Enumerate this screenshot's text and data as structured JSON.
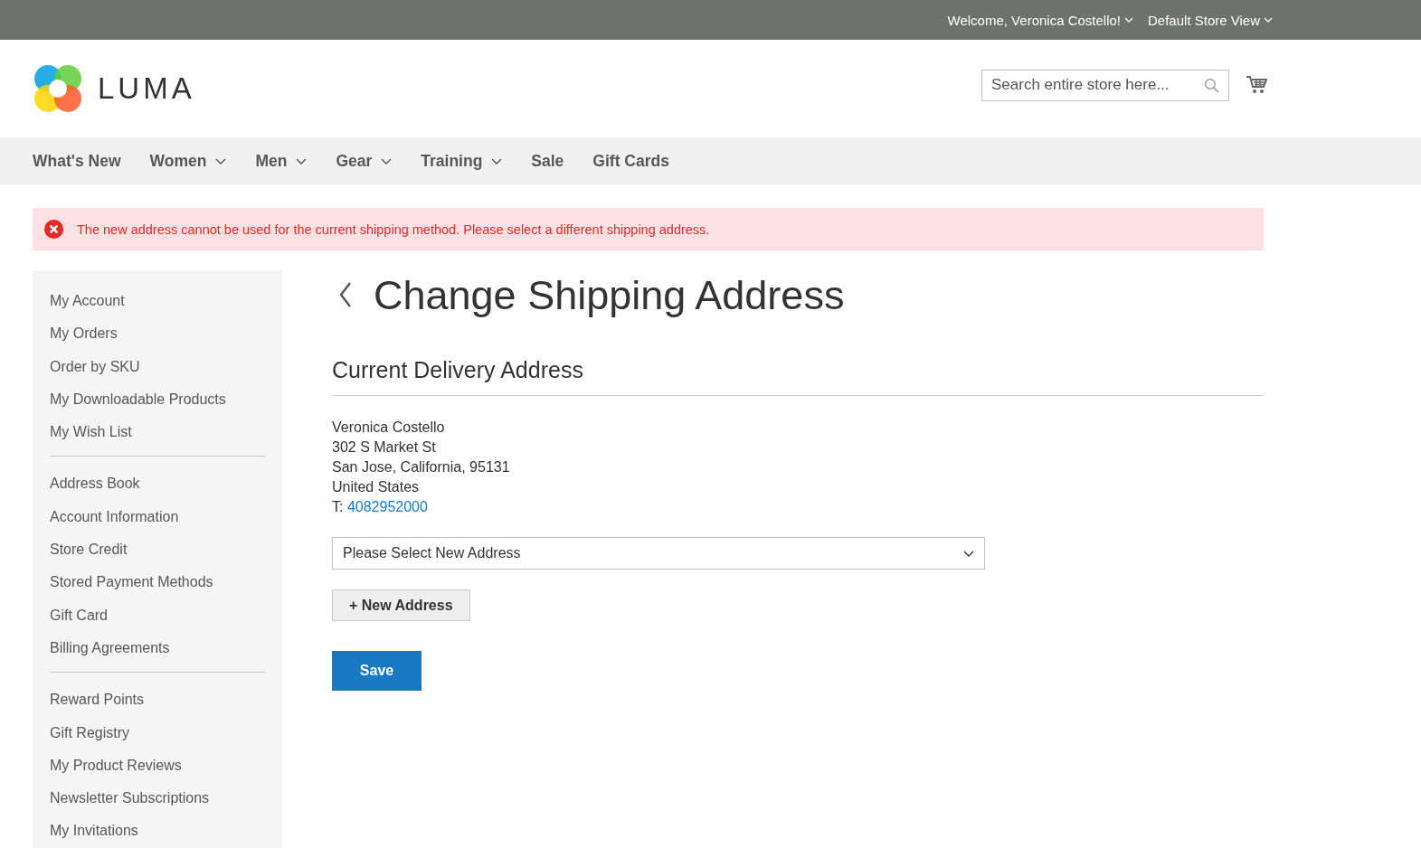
{
  "top_bar": {
    "welcome": "Welcome, Veronica Costello!",
    "store_view": "Default Store View"
  },
  "header": {
    "logo_text": "LUMA",
    "search": {
      "placeholder": "Search entire store here..."
    }
  },
  "nav": [
    {
      "label": "What's New",
      "has_submenu": false
    },
    {
      "label": "Women",
      "has_submenu": true
    },
    {
      "label": "Men",
      "has_submenu": true
    },
    {
      "label": "Gear",
      "has_submenu": true
    },
    {
      "label": "Training",
      "has_submenu": true
    },
    {
      "label": "Sale",
      "has_submenu": false
    },
    {
      "label": "Gift Cards",
      "has_submenu": false
    }
  ],
  "message": {
    "kind": "error",
    "text": "The new address cannot be used for the current shipping method. Please select a different shipping address."
  },
  "sidebar": {
    "groups": [
      [
        "My Account",
        "My Orders",
        "Order by SKU",
        "My Downloadable Products",
        "My Wish List"
      ],
      [
        "Address Book",
        "Account Information",
        "Store Credit",
        "Stored Payment Methods",
        "Gift Card",
        "Billing Agreements"
      ],
      [
        "Reward Points",
        "Gift Registry",
        "My Product Reviews",
        "Newsletter Subscriptions",
        "My Invitations"
      ]
    ]
  },
  "page_title": "Change Shipping Address",
  "section_title": "Current Delivery Address",
  "address": {
    "lines": [
      "Veronica Costello",
      "302 S Market St",
      "San Jose, California, 95131",
      "United States"
    ],
    "phone_label": "T:",
    "phone": "4082952000"
  },
  "address_select": {
    "value": "Please Select New Address"
  },
  "buttons": {
    "new_address": "+ New Address",
    "save": "Save"
  }
}
